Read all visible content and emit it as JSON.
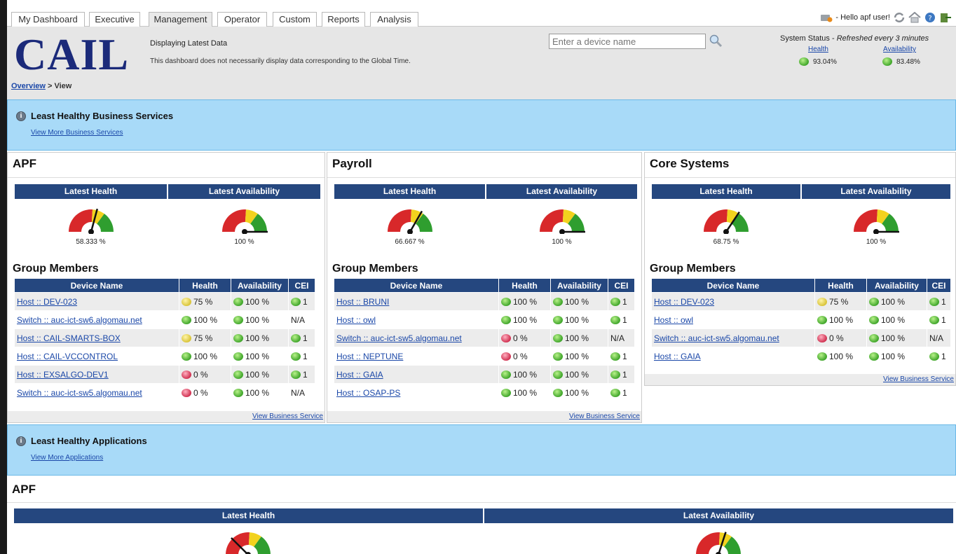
{
  "tabs": [
    "My Dashboard",
    "Executive",
    "Management",
    "Operator",
    "Custom",
    "Reports",
    "Analysis"
  ],
  "user": {
    "greeting": "- Hello apf user!"
  },
  "header": {
    "logo": "CAIL",
    "display_title": "Displaying Latest Data",
    "display_note": "This dashboard does not necessarily display data corresponding to the Global Time.",
    "search_placeholder": "Enter a device name",
    "system_status_label": "System Status -",
    "system_status_refresh": "Refreshed every 3 minutes",
    "health_label": "Health",
    "health_value": "93.04%",
    "availability_label": "Availability",
    "availability_value": "83.48%"
  },
  "breadcrumb": {
    "overview": "Overview",
    "separator": ">",
    "current": "View"
  },
  "business_banner": {
    "title": "Least Healthy Business Services",
    "link": "View More Business Services"
  },
  "columns": {
    "latest_health": "Latest Health",
    "latest_availability": "Latest Availability",
    "group_members": "Group Members",
    "device_name": "Device Name",
    "health": "Health",
    "availability": "Availability",
    "cei": "CEI",
    "view_link": "View Business Service"
  },
  "services": [
    {
      "name": "APF",
      "health": 58.333,
      "health_text": "58.333 %",
      "availability": 100,
      "availability_text": "100 %",
      "members": [
        {
          "device": "Host :: DEV-023",
          "health_status": "yellow",
          "health": "75 %",
          "avail_status": "green",
          "availability": "100 %",
          "cei_status": "green",
          "cei": "1"
        },
        {
          "device": "Switch :: auc-ict-sw6.algomau.net",
          "health_status": "green",
          "health": "100 %",
          "avail_status": "green",
          "availability": "100 %",
          "cei_status": "none",
          "cei": "N/A"
        },
        {
          "device": "Host :: CAIL-SMARTS-BOX",
          "health_status": "yellow",
          "health": "75 %",
          "avail_status": "green",
          "availability": "100 %",
          "cei_status": "green",
          "cei": "1"
        },
        {
          "device": "Host :: CAIL-VCCONTROL",
          "health_status": "green",
          "health": "100 %",
          "avail_status": "green",
          "availability": "100 %",
          "cei_status": "green",
          "cei": "1"
        },
        {
          "device": "Host :: EXSALGO-DEV1",
          "health_status": "red",
          "health": "0 %",
          "avail_status": "green",
          "availability": "100 %",
          "cei_status": "green",
          "cei": "1"
        },
        {
          "device": "Switch :: auc-ict-sw5.algomau.net",
          "health_status": "red",
          "health": "0 %",
          "avail_status": "green",
          "availability": "100 %",
          "cei_status": "none",
          "cei": "N/A"
        }
      ]
    },
    {
      "name": "Payroll",
      "health": 66.667,
      "health_text": "66.667 %",
      "availability": 100,
      "availability_text": "100 %",
      "members": [
        {
          "device": "Host :: BRUNI",
          "health_status": "green",
          "health": "100 %",
          "avail_status": "green",
          "availability": "100 %",
          "cei_status": "green",
          "cei": "1"
        },
        {
          "device": "Host :: owl",
          "health_status": "green",
          "health": "100 %",
          "avail_status": "green",
          "availability": "100 %",
          "cei_status": "green",
          "cei": "1"
        },
        {
          "device": "Switch :: auc-ict-sw5.algomau.net",
          "health_status": "red",
          "health": "0 %",
          "avail_status": "green",
          "availability": "100 %",
          "cei_status": "none",
          "cei": "N/A"
        },
        {
          "device": "Host :: NEPTUNE",
          "health_status": "red",
          "health": "0 %",
          "avail_status": "green",
          "availability": "100 %",
          "cei_status": "green",
          "cei": "1"
        },
        {
          "device": "Host :: GAIA",
          "health_status": "green",
          "health": "100 %",
          "avail_status": "green",
          "availability": "100 %",
          "cei_status": "green",
          "cei": "1"
        },
        {
          "device": "Host :: OSAP-PS",
          "health_status": "green",
          "health": "100 %",
          "avail_status": "green",
          "availability": "100 %",
          "cei_status": "green",
          "cei": "1"
        }
      ]
    },
    {
      "name": "Core Systems",
      "health": 68.75,
      "health_text": "68.75 %",
      "availability": 100,
      "availability_text": "100 %",
      "members": [
        {
          "device": "Host :: DEV-023",
          "health_status": "yellow",
          "health": "75 %",
          "avail_status": "green",
          "availability": "100 %",
          "cei_status": "green",
          "cei": "1"
        },
        {
          "device": "Host :: owl",
          "health_status": "green",
          "health": "100 %",
          "avail_status": "green",
          "availability": "100 %",
          "cei_status": "green",
          "cei": "1"
        },
        {
          "device": "Switch :: auc-ict-sw5.algomau.net",
          "health_status": "red",
          "health": "0 %",
          "avail_status": "green",
          "availability": "100 %",
          "cei_status": "none",
          "cei": "N/A"
        },
        {
          "device": "Host :: GAIA",
          "health_status": "green",
          "health": "100 %",
          "avail_status": "green",
          "availability": "100 %",
          "cei_status": "green",
          "cei": "1"
        }
      ]
    }
  ],
  "apps_banner": {
    "title": "Least Healthy Applications",
    "link": "View More Applications"
  },
  "app": {
    "name": "APF",
    "latest_health": "Latest Health",
    "latest_availability": "Latest Availability",
    "health": 25,
    "availability": 60
  },
  "colors": {
    "header_blue": "#25477f",
    "banner_blue": "#a8daf8",
    "gauge_red": "#d8282a",
    "gauge_yellow": "#f2d21e",
    "gauge_green": "#2f9e2f"
  }
}
